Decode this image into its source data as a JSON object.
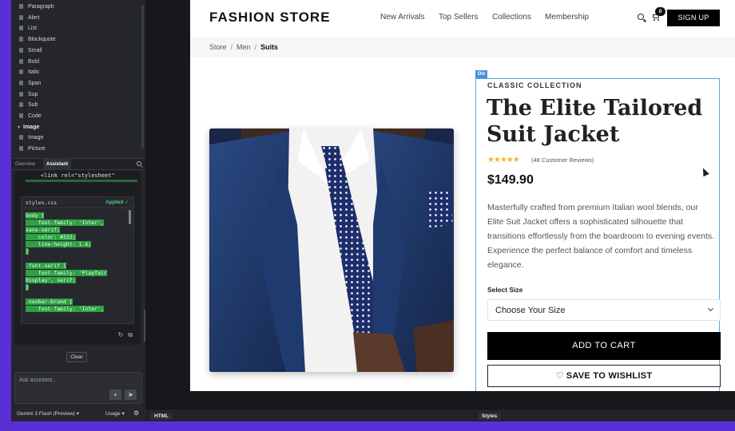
{
  "left_panel": {
    "block_items": [
      {
        "label": "Paragraph",
        "type": "item"
      },
      {
        "label": "Alert",
        "type": "item"
      },
      {
        "label": "List",
        "type": "item"
      },
      {
        "label": "Blockquote",
        "type": "item"
      },
      {
        "label": "Small",
        "type": "item"
      },
      {
        "label": "Bold",
        "type": "item"
      },
      {
        "label": "Italic",
        "type": "item"
      },
      {
        "label": "Span",
        "type": "item"
      },
      {
        "label": "Sup",
        "type": "item"
      },
      {
        "label": "Sub",
        "type": "item"
      },
      {
        "label": "Code",
        "type": "item"
      },
      {
        "label": "Image",
        "type": "group"
      },
      {
        "label": "Image",
        "type": "item"
      },
      {
        "label": "Picture",
        "type": "item"
      }
    ],
    "tabs": [
      "Overview",
      "Assistant"
    ],
    "active_tab": "Assistant",
    "code_head_line": "<link rel=\"stylesheet\"",
    "css_file": {
      "name": "styles.css",
      "status": "Applied ✓",
      "lines": [
        "body {",
        "    font-family: 'Inter',",
        "sans-serif;",
        "    color: #333;",
        "    line-height: 1.6;",
        "}",
        "",
        ".font-serif {",
        "    font-family: 'Playfair",
        "Display', serif;",
        "}",
        "",
        ".navbar-brand {",
        "    font-family: 'Inter',"
      ]
    },
    "clear_label": "Clear",
    "ask_placeholder": "Ask assistant..",
    "model_label": "Gemini 3 Flash (Preview) ▾",
    "usage_label": "Usage ▾"
  },
  "bottom_bar": {
    "html_tab": "HTML",
    "styles_tab": "Styles"
  },
  "site": {
    "brand": "FASHION STORE",
    "nav_links": [
      "New Arrivals",
      "Top Sellers",
      "Collections",
      "Membership"
    ],
    "cart_count": "0",
    "signup": "SIGN UP",
    "breadcrumb": [
      "Store",
      "Men",
      "Suits"
    ],
    "badge": "Div",
    "collection": "CLASSIC COLLECTION",
    "title": "The Elite Tailored Suit Jacket",
    "rating_stars": "★★★★★",
    "rating": 4.5,
    "reviews": "(48 Customer Reviews)",
    "price": "$149.90",
    "description": "Masterfully crafted from premium Italian wool blends, our Elite Suit Jacket offers a sophisticated silhouette that transitions effortlessly from the boardroom to evening events. Experience the perfect balance of comfort and timeless elegance.",
    "size_label": "Select Size",
    "size_value": "Choose Your Size",
    "add_to_cart": "ADD TO CART",
    "wishlist": "SAVE TO WISHLIST",
    "colors": {
      "star": "#f0b429",
      "primary": "#000000",
      "editor_bg": "#24262b",
      "backdrop": "#5b2fd6",
      "highlight": "#2ea043",
      "select_outline": "#5fa3e6"
    }
  }
}
